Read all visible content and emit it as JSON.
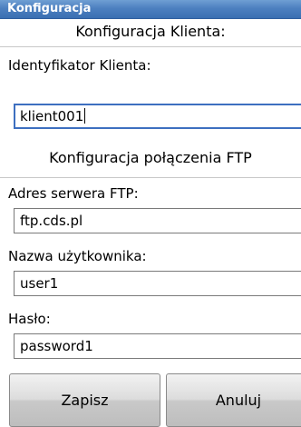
{
  "window": {
    "title": "Konfiguracja"
  },
  "client_section": {
    "header": "Konfiguracja Klienta:",
    "id_label": "Identyfikator Klienta:",
    "id_value": "klient001"
  },
  "ftp_section": {
    "header": "Konfiguracja połączenia FTP",
    "server_label": "Adres serwera FTP:",
    "server_value": "ftp.cds.pl",
    "user_label": "Nazwa użytkownika:",
    "user_value": "user1",
    "password_label": "Hasło:",
    "password_value": "password1"
  },
  "buttons": {
    "save_label": "Zapisz",
    "cancel_label": "Anuluj"
  },
  "colors": {
    "titlebar": "#4d80c0",
    "focus_border": "#3d6fc0"
  }
}
